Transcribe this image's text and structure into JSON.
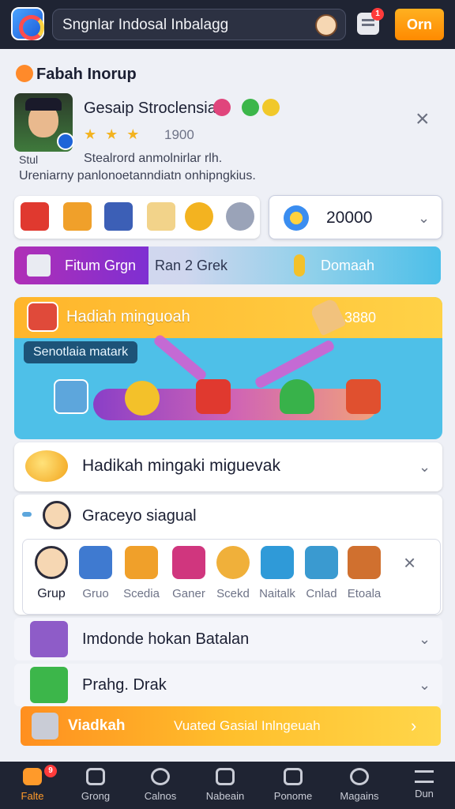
{
  "topbar": {
    "search_text": "Sngnlar Indosal Inbalagg",
    "mail_badge": "1",
    "action_label": "Orn"
  },
  "profile": {
    "section_title": "Fabah Inorup",
    "name": "Gesaip Stroclensia",
    "stars": "★ ★ ★",
    "level_value": "1900",
    "sub_left": "Stul",
    "sub_right": "Stealrord anmolnirlar rlh.",
    "description": "Ureniarny panlonoetanndiatn onhipngkius."
  },
  "wallet": {
    "coin_value": "20000"
  },
  "tabs": [
    {
      "label": "Fitum Grgn",
      "active": true
    },
    {
      "label": "Ran 2 Grek",
      "active": false
    },
    {
      "label": "Domaah",
      "active": false
    }
  ],
  "hero": {
    "title": "Hadiah minguoah",
    "amount": "3880",
    "pill": "Senotlaia matark"
  },
  "reward_card": {
    "title": "Hadikah mingaki miguevak"
  },
  "group_card": {
    "title": "Graceyo siagual",
    "items": [
      {
        "label": "Grup"
      },
      {
        "label": "Gruo"
      },
      {
        "label": "Scedia"
      },
      {
        "label": "Ganer"
      },
      {
        "label": "Scekd"
      },
      {
        "label": "Naitalk"
      },
      {
        "label": "Cnlad"
      },
      {
        "label": "Etoala"
      }
    ]
  },
  "rows": [
    {
      "label": "Imdonde hokan Batalan"
    },
    {
      "label": "Prahg. Drak"
    }
  ],
  "promo": {
    "title": "Viadkah",
    "text": "Vuated Gasial Inlngeuah"
  },
  "bottom_nav": [
    {
      "label": "Falte",
      "badge": "9",
      "active": true
    },
    {
      "label": "Grong",
      "active": false
    },
    {
      "label": "Calnos",
      "active": false
    },
    {
      "label": "Nabeain",
      "active": false
    },
    {
      "label": "Ponome",
      "active": false
    },
    {
      "label": "Magains",
      "active": false
    },
    {
      "label": "Dun",
      "active": false
    }
  ],
  "colors": {
    "accent": "#ff9a2a",
    "topbar": "#1f2433",
    "tab_active": "#b02fb6",
    "hero_blue": "#4ec0e8"
  }
}
